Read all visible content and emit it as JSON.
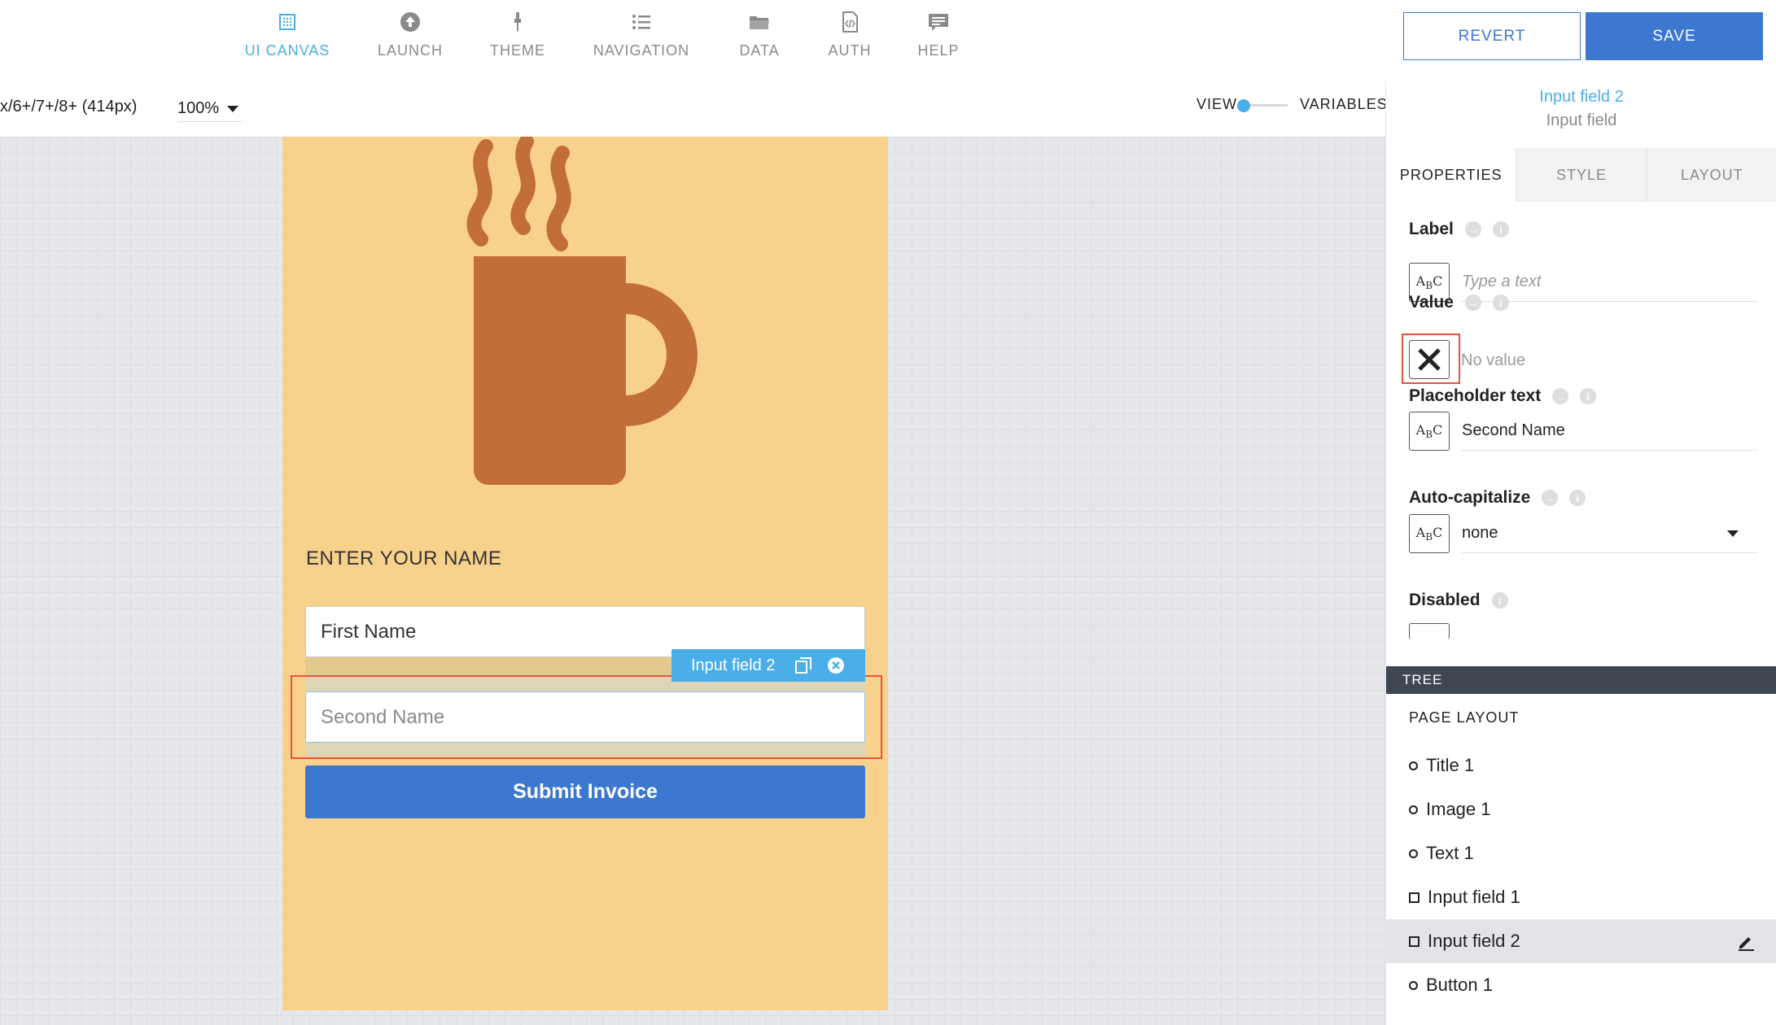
{
  "nav": {
    "items": [
      {
        "label": "UI CANVAS",
        "icon": "ui-canvas-icon",
        "active": true
      },
      {
        "label": "LAUNCH",
        "icon": "launch-icon",
        "active": false
      },
      {
        "label": "THEME",
        "icon": "theme-icon",
        "active": false
      },
      {
        "label": "NAVIGATION",
        "icon": "navigation-icon",
        "active": false
      },
      {
        "label": "DATA",
        "icon": "data-folder-icon",
        "active": false
      },
      {
        "label": "AUTH",
        "icon": "auth-file-icon",
        "active": false
      },
      {
        "label": "HELP",
        "icon": "help-chat-icon",
        "active": false
      }
    ],
    "revert_label": "REVERT",
    "save_label": "SAVE"
  },
  "toolbar": {
    "device": "x/6+/7+/8+ (414px)",
    "zoom": "100%",
    "view_label": "VIEW",
    "variables_label": "VARIABLES"
  },
  "canvas": {
    "heading": "ENTER YOUR NAME",
    "first_name_value": "First Name",
    "second_name_placeholder": "Second Name",
    "selected_tag": "Input field 2",
    "submit_label": "Submit Invoice"
  },
  "panel": {
    "selected_name": "Input field 2",
    "selected_type": "Input field",
    "tabs": [
      "PROPERTIES",
      "STYLE",
      "LAYOUT"
    ],
    "label": {
      "title": "Label",
      "placeholder": "Type a text"
    },
    "value": {
      "title": "Value",
      "text": "No value"
    },
    "placeholder_text": {
      "title": "Placeholder text",
      "value": "Second Name"
    },
    "auto_capitalize": {
      "title": "Auto-capitalize",
      "value": "none"
    },
    "disabled": {
      "title": "Disabled"
    },
    "abc_icon_text": "ABC"
  },
  "tree": {
    "header": "TREE",
    "section": "PAGE LAYOUT",
    "items": [
      {
        "label": "Title 1",
        "kind": "dot"
      },
      {
        "label": "Image 1",
        "kind": "dot"
      },
      {
        "label": "Text 1",
        "kind": "dot"
      },
      {
        "label": "Input field 1",
        "kind": "square"
      },
      {
        "label": "Input field 2",
        "kind": "square",
        "selected": true
      },
      {
        "label": "Button 1",
        "kind": "dot"
      }
    ]
  },
  "colors": {
    "accent": "#4aaee8",
    "primary": "#3c78d0",
    "selection": "#e8533b",
    "phone_bg": "#f8d18c",
    "mug": "#c26e39"
  }
}
